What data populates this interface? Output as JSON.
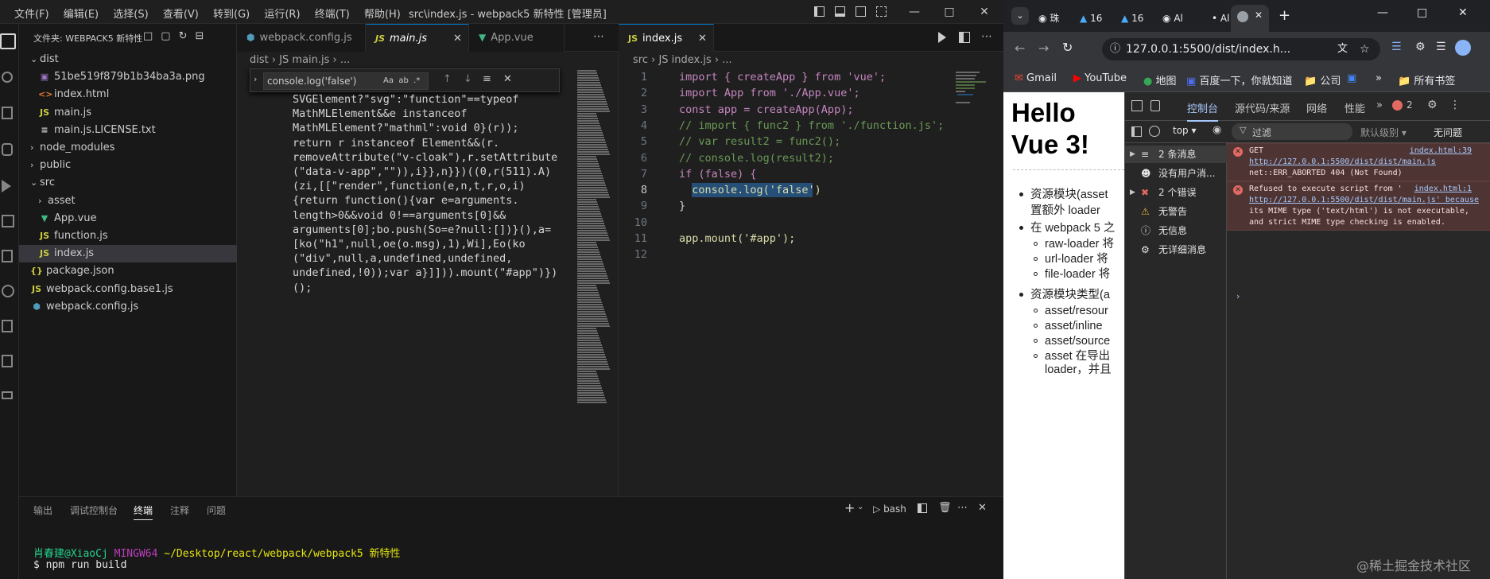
{
  "vscode": {
    "menu": [
      "文件(F)",
      "编辑(E)",
      "选择(S)",
      "查看(V)",
      "转到(G)",
      "运行(R)",
      "终端(T)",
      "帮助(H)"
    ],
    "window_title": "src\\index.js - webpack5 新特性 [管理员]",
    "explorer_title": "文件夹: WEBPACK5 新特性",
    "tree": [
      {
        "label": "dist",
        "type": "folder",
        "open": true
      },
      {
        "label": "51be519f879b1b34ba3a.png",
        "type": "img"
      },
      {
        "label": "index.html",
        "type": "html"
      },
      {
        "label": "main.js",
        "type": "js"
      },
      {
        "label": "main.js.LICENSE.txt",
        "type": "txt"
      },
      {
        "label": "node_modules",
        "type": "folder",
        "open": false
      },
      {
        "label": "public",
        "type": "folder",
        "open": false
      },
      {
        "label": "src",
        "type": "folder",
        "open": true
      },
      {
        "label": "asset",
        "type": "folder",
        "open": false
      },
      {
        "label": "App.vue",
        "type": "vue"
      },
      {
        "label": "function.js",
        "type": "js"
      },
      {
        "label": "index.js",
        "type": "js",
        "selected": true
      },
      {
        "label": "package.json",
        "type": "json"
      },
      {
        "label": "webpack.config.base1.js",
        "type": "js"
      },
      {
        "label": "webpack.config.js",
        "type": "cfg"
      }
    ],
    "left_tabs": [
      {
        "label": "webpack.config.js",
        "icon": "cfg"
      },
      {
        "label": "main.js",
        "icon": "JS",
        "active": true
      },
      {
        "label": "App.vue",
        "icon": "vue"
      }
    ],
    "left_crumb": [
      "dist",
      "JS main.js",
      "..."
    ],
    "find_query": "console.log('false')",
    "find_opts": [
      "Aa",
      "ab",
      ".*"
    ],
    "left_code": [
      "SVGElement?\"svg\":\"function\"==typeof",
      "MathMLElement&&e instanceof",
      "MathMLElement?\"mathml\":void 0}(r));",
      "return r instanceof Element&&(r.",
      "removeAttribute(\"v-cloak\"),r.setAttribute",
      "(\"data-v-app\",\"\")),i}},n}})((0,r(511).A)",
      "(zi,[[\"render\",function(e,n,t,r,o,i)",
      "{return function(){var e=arguments.",
      "length>0&&void 0!==arguments[0]&&",
      "arguments[0];bo.push(So=e?null:[])}(),a=",
      "[ko(\"h1\",null,oe(o.msg),1),Wi],Eo(ko",
      "(\"div\",null,a,undefined,undefined,",
      "undefined,!0));var a}]])).mount(\"#app\")})",
      "();"
    ],
    "right_tab": {
      "label": "index.js",
      "icon": "JS"
    },
    "right_crumb": [
      "src",
      "JS index.js",
      "..."
    ],
    "right_code": [
      {
        "n": "1",
        "text": "import { createApp } from 'vue';"
      },
      {
        "n": "2",
        "text": "import App from './App.vue';"
      },
      {
        "n": "3",
        "text": "const app = createApp(App);"
      },
      {
        "n": "4",
        "text": "// import { func2 } from './function.js';"
      },
      {
        "n": "5",
        "text": "// var result2 = func2();"
      },
      {
        "n": "6",
        "text": "// console.log(result2);"
      },
      {
        "n": "7",
        "text": "if (false) {"
      },
      {
        "n": "8",
        "text": "  console.log('false')"
      },
      {
        "n": "9",
        "text": "}"
      },
      {
        "n": "10",
        "text": ""
      },
      {
        "n": "11",
        "text": "app.mount('#app');"
      },
      {
        "n": "12",
        "text": ""
      }
    ],
    "panel_tabs": [
      "输出",
      "调试控制台",
      "终端",
      "注释",
      "问题"
    ],
    "panel_active": "终端",
    "terminal_shell": "bash",
    "terminal_user": "肖春建@XiaoCj",
    "terminal_env": "MINGW64",
    "terminal_path": "~/Desktop/react/webpack/webpack5 新特性",
    "terminal_cmd": "$ npm run build"
  },
  "chrome": {
    "tabs": [
      "珠",
      "16",
      "16",
      "Al",
      "Al"
    ],
    "url": "127.0.0.1:5500/dist/index.h...",
    "bookmarks": [
      "Gmail",
      "YouTube",
      "地图",
      "百度一下，你就知道",
      "公司",
      "所有书签"
    ],
    "page_heading": "Hello Vue 3!",
    "page_items": [
      "资源模块(asset",
      "置额外 loader",
      "在 webpack 5 之",
      "raw-loader 将",
      "url-loader 将",
      "file-loader 将",
      "资源模块类型(a",
      "asset/resour",
      "asset/inline",
      "asset/source",
      "asset 在导出",
      "loader，并且"
    ],
    "devtools_tabs": [
      "控制台",
      "源代码/来源",
      "网络",
      "性能"
    ],
    "devtools_active": "控制台",
    "error_count": "2",
    "console_context": "top",
    "filter_placeholder": "过滤",
    "level_label": "默认级别",
    "issues_label": "无问题",
    "sidebar": [
      "2 条消息",
      "没有用户消...",
      "2 个错误",
      "无警告",
      "无信息",
      "无详细消息"
    ],
    "errors": [
      {
        "lines": [
          "GET",
          "http://127.0.0.1:5500/dist/dist/main.js",
          "net::ERR_ABORTED 404 (Not Found)"
        ],
        "source": "index.html:39"
      },
      {
        "lines": [
          "Refused to execute script from '",
          "http://127.0.0.1:5500/dist/dist/main.js' because",
          "its MIME type ('text/html') is not executable,",
          "and strict MIME type checking is enabled."
        ],
        "source": "index.html:1"
      }
    ]
  },
  "watermark": "@稀土掘金技术社区"
}
